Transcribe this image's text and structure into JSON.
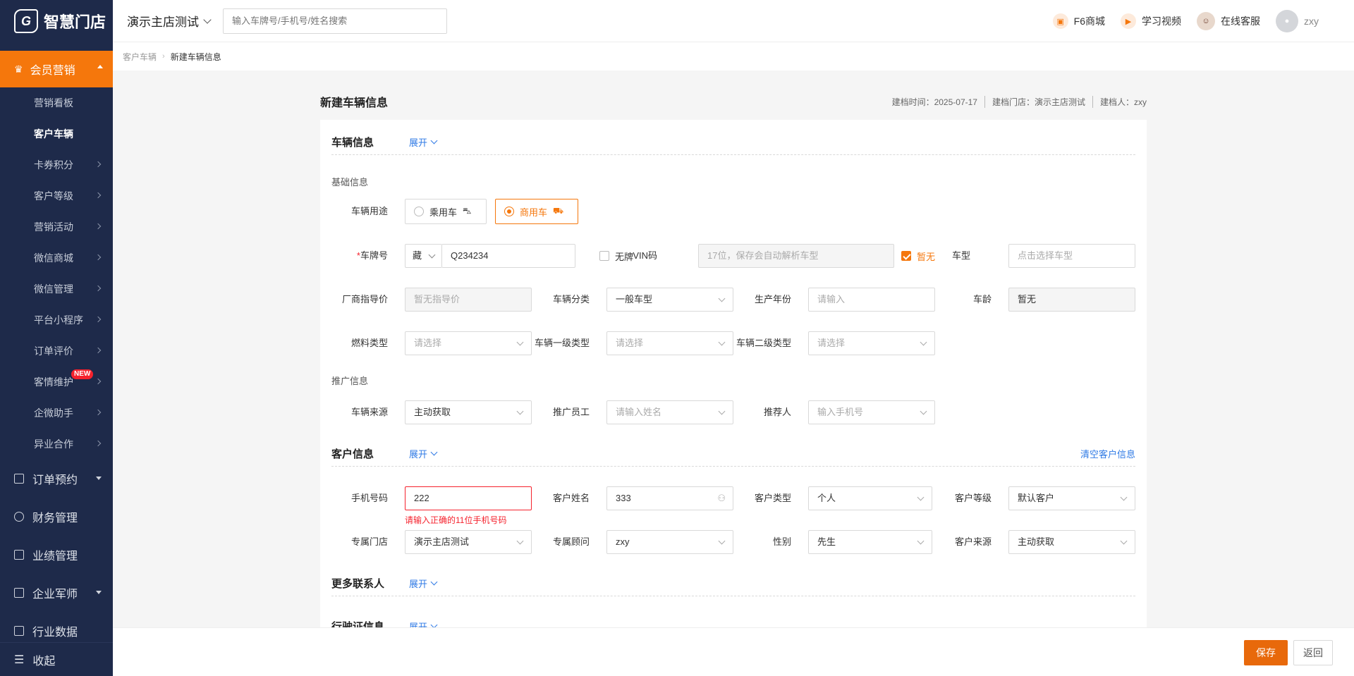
{
  "app": {
    "logo_text": "智慧门店",
    "logo_mark": "G"
  },
  "sidebar": {
    "active_group": "会员营销",
    "sub_items": [
      {
        "label": "营销看板",
        "arrow": false,
        "current": false
      },
      {
        "label": "客户车辆",
        "arrow": false,
        "current": true
      },
      {
        "label": "卡券积分",
        "arrow": true,
        "current": false
      },
      {
        "label": "客户等级",
        "arrow": true,
        "current": false
      },
      {
        "label": "营销活动",
        "arrow": true,
        "current": false
      },
      {
        "label": "微信商城",
        "arrow": true,
        "current": false
      },
      {
        "label": "微信管理",
        "arrow": true,
        "current": false
      },
      {
        "label": "平台小程序",
        "arrow": true,
        "current": false
      },
      {
        "label": "订单评价",
        "arrow": true,
        "current": false
      },
      {
        "label": "客情维护",
        "arrow": true,
        "current": false,
        "badge": "NEW"
      },
      {
        "label": "企微助手",
        "arrow": true,
        "current": false
      },
      {
        "label": "异业合作",
        "arrow": true,
        "current": false
      }
    ],
    "main_items": [
      {
        "label": "订单预约",
        "dropdown": true
      },
      {
        "label": "财务管理",
        "dropdown": false
      },
      {
        "label": "业绩管理",
        "dropdown": false
      },
      {
        "label": "企业军师",
        "dropdown": true
      },
      {
        "label": "行业数据",
        "dropdown": false
      }
    ],
    "collapse_label": "收起"
  },
  "topbar": {
    "store_name": "演示主店测试",
    "search_placeholder": "输入车牌号/手机号/姓名搜索",
    "links": [
      {
        "label": "F6商城",
        "icon": "shop-icon"
      },
      {
        "label": "学习视频",
        "icon": "play-icon"
      },
      {
        "label": "在线客服",
        "icon": "service-avatar-icon"
      },
      {
        "label": "zxy",
        "icon": "user-avatar-icon"
      }
    ]
  },
  "breadcrumb": {
    "parent": "客户车辆",
    "current": "新建车辆信息"
  },
  "page": {
    "title": "新建车辆信息",
    "meta_date": "建档时间：2025-07-17",
    "meta_store": "建档门店：演示主店测试",
    "meta_person": "建档人：zxy"
  },
  "vehicle": {
    "section_title": "车辆信息",
    "expand_label": "展开",
    "basic_label": "基础信息",
    "usage_label": "车辆用途",
    "usage_options": [
      "乘用车",
      "商用车"
    ],
    "usage_selected": "商用车",
    "plate_label": "车牌号",
    "plate_province": "藏",
    "plate_value": "Q234234",
    "no_plate_label": "无牌",
    "vin_label": "VIN码",
    "vin_placeholder": "17位，保存会自动解析车型",
    "vin_none_label": "暂无",
    "model_label": "车型",
    "model_placeholder": "点击选择车型",
    "guide_price_label": "厂商指导价",
    "guide_price_placeholder": "暂无指导价",
    "category_label": "车辆分类",
    "category_value": "一般车型",
    "year_label": "生产年份",
    "year_placeholder": "请输入",
    "age_label": "车龄",
    "age_value": "暂无",
    "fuel_label": "燃料类型",
    "fuel_placeholder": "请选择",
    "type1_label": "车辆一级类型",
    "type1_placeholder": "请选择",
    "type2_label": "车辆二级类型",
    "type2_placeholder": "请选择",
    "promo_label": "推广信息",
    "source_label": "车辆来源",
    "source_value": "主动获取",
    "staff_label": "推广员工",
    "staff_placeholder": "请输入姓名",
    "referrer_label": "推荐人",
    "referrer_placeholder": "输入手机号"
  },
  "customer": {
    "section_title": "客户信息",
    "expand_label": "展开",
    "clear_label": "清空客户信息",
    "phone_label": "手机号码",
    "phone_value": "222",
    "phone_error": "请输入正确的11位手机号码",
    "name_label": "客户姓名",
    "name_value": "333",
    "type_label": "客户类型",
    "type_value": "个人",
    "level_label": "客户等级",
    "level_value": "默认客户",
    "store_label": "专属门店",
    "store_value": "演示主店测试",
    "advisor_label": "专属顾问",
    "advisor_value": "zxy",
    "gender_label": "性别",
    "gender_value": "先生",
    "source_label": "客户来源",
    "source_value": "主动获取"
  },
  "contacts": {
    "section_title": "更多联系人",
    "expand_label": "展开"
  },
  "license": {
    "section_title": "行驶证信息",
    "expand_label": "展开"
  },
  "footer": {
    "save_label": "保存",
    "back_label": "返回"
  },
  "colors": {
    "accent": "#f5770c",
    "sidebar_bg": "#1e2a4a",
    "link": "#2f7ae5",
    "error": "#f5222d"
  }
}
